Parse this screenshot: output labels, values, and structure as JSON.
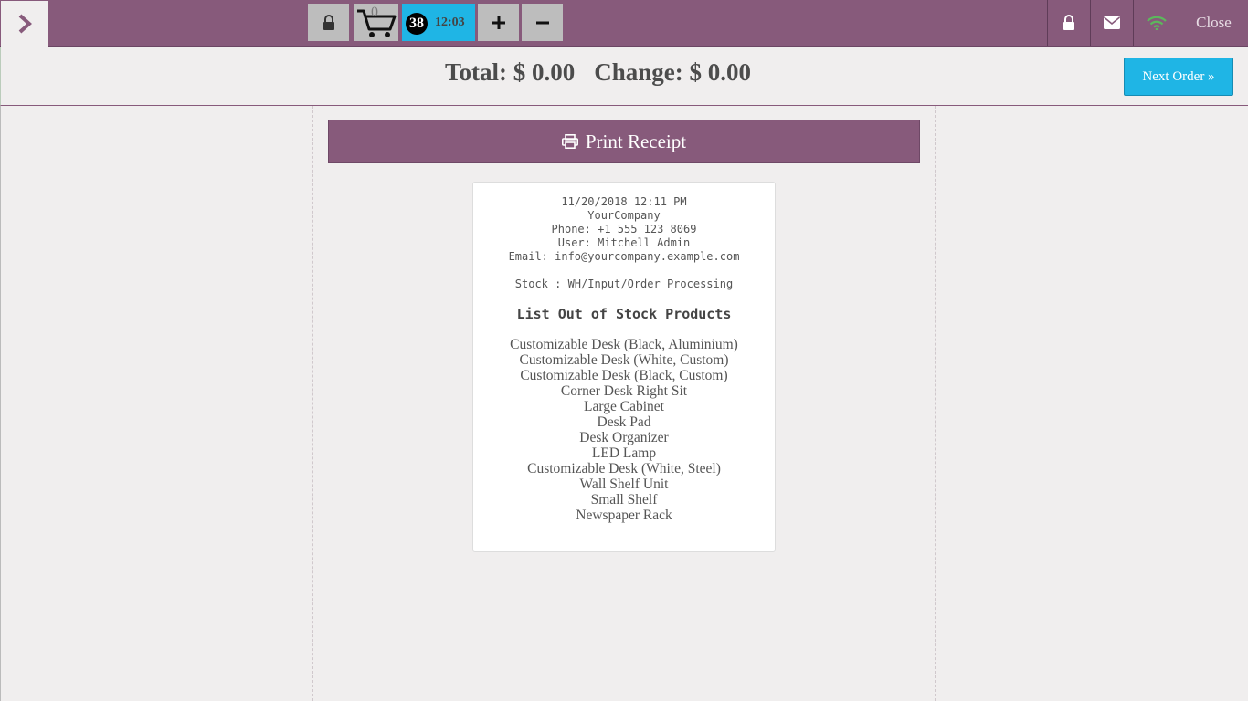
{
  "topbar": {
    "cart_count": "0",
    "order_number": "38",
    "order_time": "12:03",
    "close_label": "Close"
  },
  "summary": {
    "total": "Total: $ 0.00",
    "change": "Change: $ 0.00",
    "next_order_label": "Next Order »"
  },
  "print_receipt_label": "Print Receipt",
  "receipt": {
    "datetime": "11/20/2018 12:11 PM",
    "company": "YourCompany",
    "phone": "Phone: +1 555 123 8069",
    "user": "User: Mitchell Admin",
    "email": "Email: info@yourcompany.example.com",
    "stock": "Stock : WH/Input/Order Processing",
    "title": "List Out of Stock Products",
    "items": [
      "Customizable Desk (Black, Aluminium)",
      "Customizable Desk (White, Custom)",
      "Customizable Desk (Black, Custom)",
      "Corner Desk Right Sit",
      "Large Cabinet",
      "Desk Pad",
      "Desk Organizer",
      "LED Lamp",
      "Customizable Desk (White, Steel)",
      "Wall Shelf Unit",
      "Small Shelf",
      "Newspaper Rack"
    ]
  },
  "colors": {
    "brand": "#875a7b",
    "accent": "#1fb5e5",
    "wifi_ok": "#5cb85c"
  }
}
